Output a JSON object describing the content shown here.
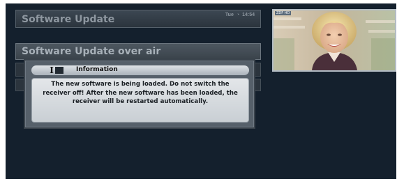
{
  "header": {
    "title": "Software Update",
    "day": "Tue",
    "time": "14:54",
    "clock_icon": "clock-icon"
  },
  "menu": {
    "selected_item": "Software Update over air"
  },
  "dialog": {
    "title": "Information",
    "icon": "info-icon",
    "message": "The new software is being loaded. Do not switch the receiver off! After the new software has been loaded, the receiver will be restarted automatically."
  },
  "preview": {
    "channel_label": "ZDF HD"
  },
  "colors": {
    "background": "#14202d",
    "dialog_body": "#d6dadf",
    "header_text": "#8e97a0"
  }
}
